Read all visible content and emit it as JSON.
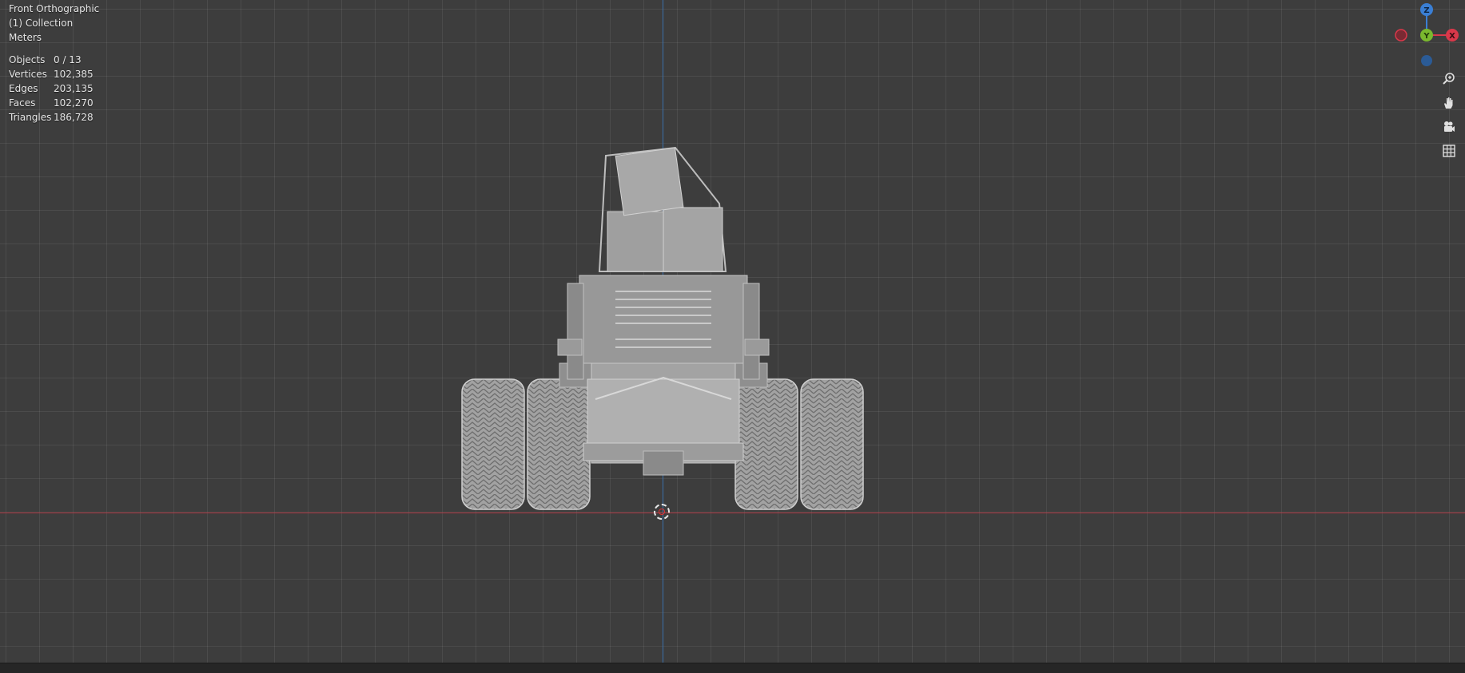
{
  "viewport": {
    "view_name": "Front Orthographic",
    "collection": "(1) Collection",
    "units": "Meters"
  },
  "stats": [
    {
      "label": "Objects",
      "value": "0 / 13"
    },
    {
      "label": "Vertices",
      "value": "102,385"
    },
    {
      "label": "Edges",
      "value": "203,135"
    },
    {
      "label": "Faces",
      "value": "102,270"
    },
    {
      "label": "Triangles",
      "value": "186,728"
    }
  ],
  "gizmo": {
    "z_label": "Z",
    "y_label": "Y",
    "x_label": "X",
    "colors": {
      "x": "#d9384a",
      "y": "#7ab82e",
      "z": "#3a7fd5"
    }
  },
  "nav_buttons": [
    {
      "icon": "zoom-icon"
    },
    {
      "icon": "hand-pan-icon"
    },
    {
      "icon": "camera-icon"
    },
    {
      "icon": "grid-ortho-icon"
    }
  ],
  "colors": {
    "background": "#3d3d3d",
    "axis_x": "#a8343f",
    "axis_z": "#3b6fa8",
    "mesh": "#9a9a9a"
  }
}
